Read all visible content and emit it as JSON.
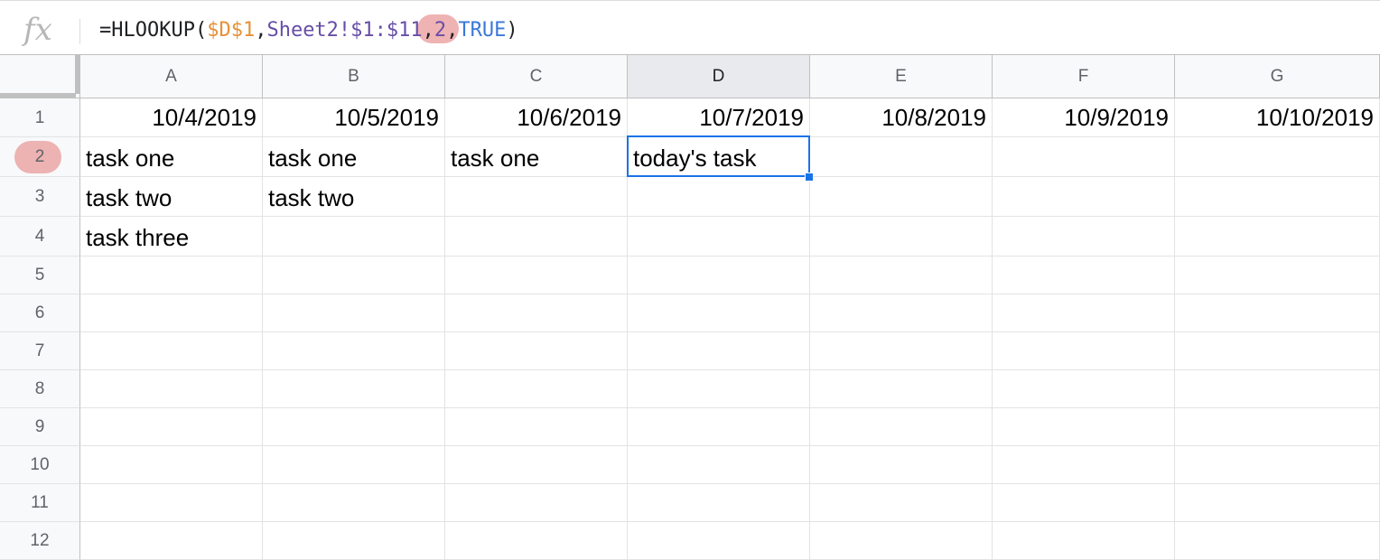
{
  "formula_bar": {
    "fx_icon": "fx",
    "prefix": "=HLOOKUP(",
    "ref1": "$D$1",
    "comma1": ",",
    "ref2": "Sheet2!$1:$11",
    "comma2": ",",
    "index": "2",
    "comma3": ",",
    "bool": "TRUE",
    "suffix": ")"
  },
  "columns": [
    "A",
    "B",
    "C",
    "D",
    "E",
    "F",
    "G"
  ],
  "rows": [
    "1",
    "2",
    "3",
    "4",
    "5",
    "6",
    "7",
    "8",
    "9",
    "10",
    "11",
    "12"
  ],
  "cells": {
    "A1": "10/4/2019",
    "B1": "10/5/2019",
    "C1": "10/6/2019",
    "D1": "10/7/2019",
    "E1": "10/8/2019",
    "F1": "10/9/2019",
    "G1": "10/10/2019",
    "A2": "task one",
    "B2": "task one",
    "C2": "task one",
    "D2": "today's task",
    "A3": "task two",
    "B3": "task two",
    "A4": "task three"
  },
  "active_cell": "D2",
  "colors": {
    "ref1": "#e69138",
    "ref2": "#674ea7",
    "bool": "#3c78d8",
    "selection": "#1a73e8",
    "annotation": "#ea9999"
  }
}
